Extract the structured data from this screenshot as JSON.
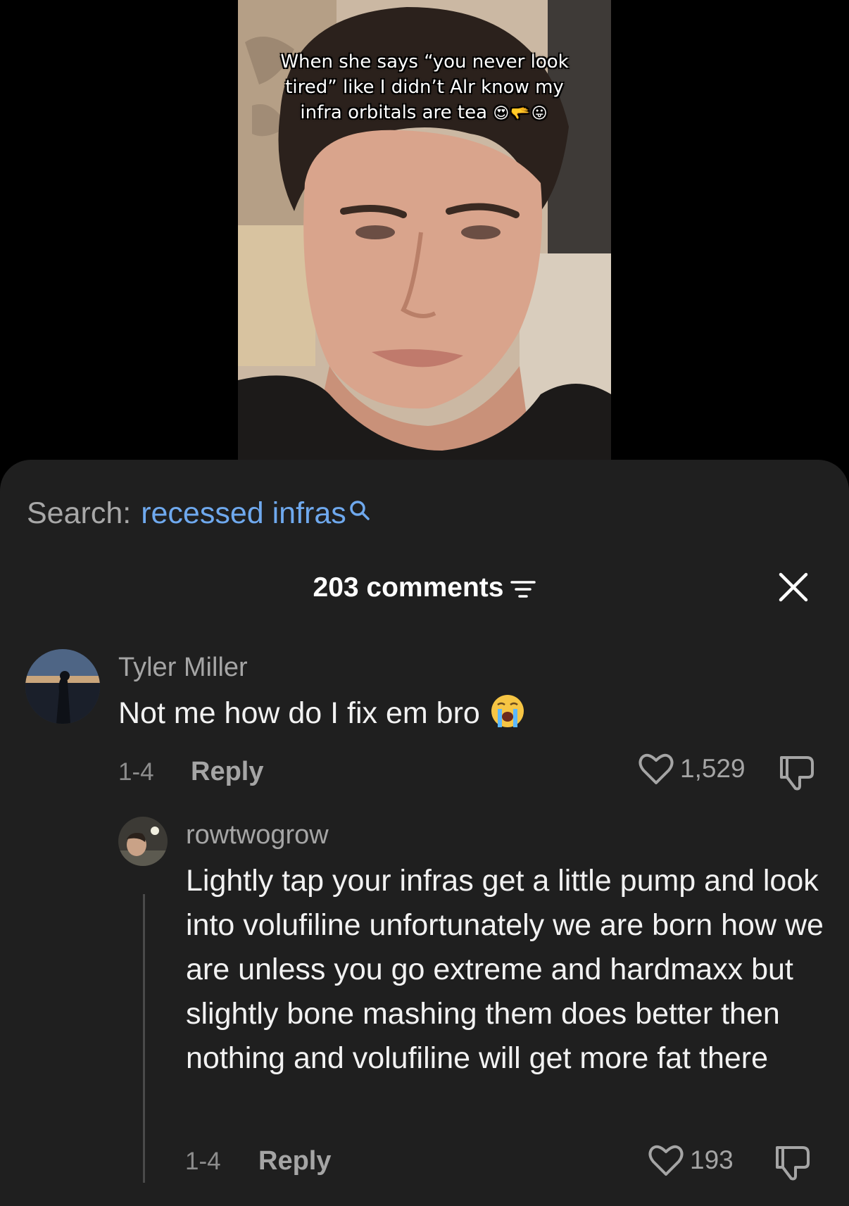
{
  "video": {
    "caption": "When she says “you never look tired” like I didn’t Alr know my infra orbitals are tea",
    "caption_emojis": "😍🫳😛"
  },
  "search": {
    "prefix": "Search:",
    "term": "recessed infras"
  },
  "header": {
    "comment_count": "203 comments"
  },
  "comments": [
    {
      "username": "Tyler Miller",
      "text": "Not me how do I fix em bro",
      "date": "1-4",
      "reply_label": "Reply",
      "likes": "1,529"
    },
    {
      "username": "rowtwogrow",
      "text": "Lightly tap your infras get a little pump and look into volufiline unfortunately we are born how we are unless you go extreme and hardmaxx but slightly bone mashing them does better then nothing and volufiline will get more fat there",
      "date": "1-4",
      "reply_label": "Reply",
      "likes": "193"
    }
  ],
  "colors": {
    "sheet_bg": "#1f1f1f",
    "search_link": "#6fa9ee",
    "secondary_text": "#a5a5a5"
  }
}
